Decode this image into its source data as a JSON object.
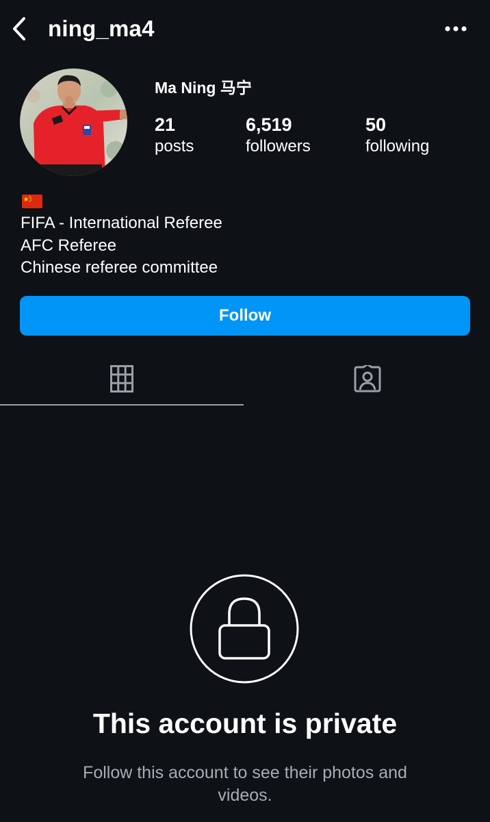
{
  "header": {
    "username": "ning_ma4",
    "icons": {
      "back": "chevron-left-icon",
      "more": "more-horizontal-icon"
    }
  },
  "profile": {
    "display_name": "Ma Ning 马宁",
    "stats": {
      "posts": {
        "value": "21",
        "label": "posts"
      },
      "followers": {
        "value": "6,519",
        "label": "followers"
      },
      "following": {
        "value": "50",
        "label": "following"
      }
    },
    "bio": {
      "flag_icon": "china-flag-icon",
      "lines": [
        "FIFA - International Referee",
        "AFC Referee",
        "Chinese referee committee"
      ]
    },
    "follow_button": "Follow"
  },
  "tabs": [
    {
      "name": "posts-grid",
      "icon": "grid-icon",
      "active": true
    },
    {
      "name": "tagged",
      "icon": "tagged-person-icon",
      "active": false
    }
  ],
  "private_notice": {
    "icon": "lock-icon",
    "title": "This account is private",
    "subtitle": "Follow this account to see their photos and videos."
  },
  "colors": {
    "background": "#0e1116",
    "accent": "#0095f6",
    "text": "#ffffff",
    "muted": "#a8adb4"
  }
}
